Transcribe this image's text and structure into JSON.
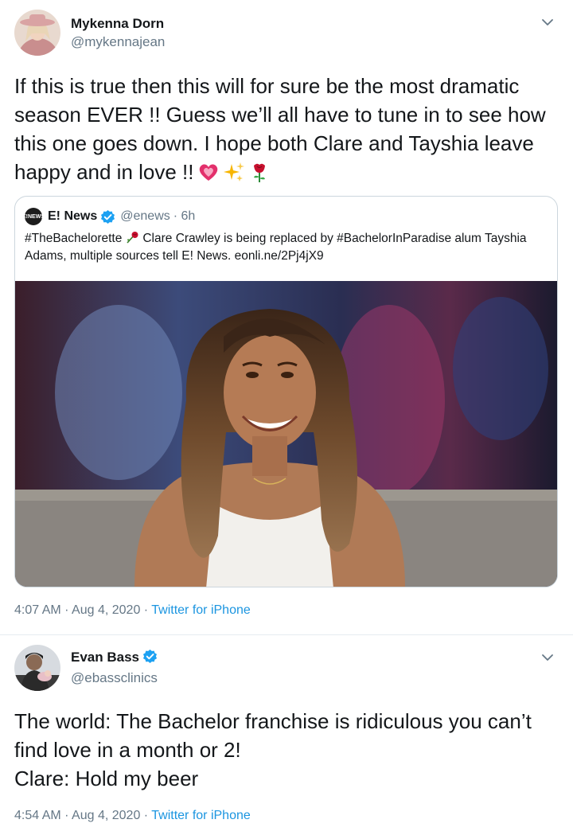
{
  "tweets": [
    {
      "author": {
        "name": "Mykenna Dorn",
        "handle": "@mykennajean",
        "verified": false
      },
      "text": "If this is true then this will for sure be the most dramatic season EVER !! Guess we’ll all have to tune in to see how this one goes down. I hope both Clare and Tayshia leave happy and in love !!",
      "emojis": [
        "heart-icon",
        "sparkles-icon",
        "rose-icon"
      ],
      "quoted": {
        "name": "E! News",
        "handle": "@enews",
        "age": "· 6h",
        "logo_text": "E!NEWS",
        "text_part1": "#TheBachelorette",
        "text_part2": "Clare Crawley is being replaced by #BachelorInParadise alum Tayshia Adams, multiple sources tell E! News. eonli.ne/2Pj4jX9"
      },
      "timestamp": "4:07 AM · Aug 4, 2020 ·",
      "source": "Twitter for iPhone"
    },
    {
      "author": {
        "name": "Evan Bass",
        "handle": "@ebassclinics",
        "verified": true
      },
      "text_lines": [
        "The world: The Bachelor franchise is ridiculous you can’t find love in a month or 2!",
        "Clare: Hold my beer"
      ],
      "timestamp": "4:54 AM · Aug 4, 2020 ·",
      "source": "Twitter for iPhone"
    }
  ],
  "colors": {
    "accent": "#1b95e0",
    "verified": "#1da1f2",
    "muted": "#657786",
    "text": "#14171a"
  }
}
